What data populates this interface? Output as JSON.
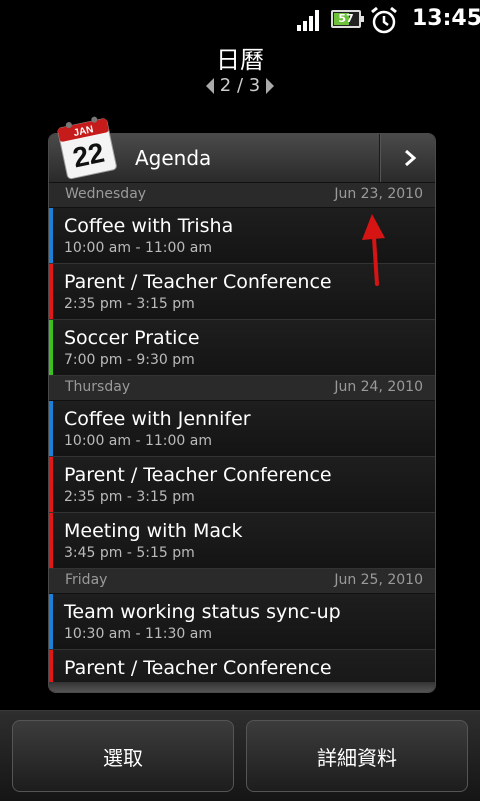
{
  "status_bar": {
    "battery_level": "57",
    "time": "13:45",
    "icons": [
      "signal-icon",
      "battery-icon",
      "alarm-clock-icon"
    ]
  },
  "header": {
    "title": "日曆",
    "page_indicator": "2 / 3"
  },
  "widget": {
    "title": "Agenda",
    "calendar_icon": {
      "month": "JAN",
      "day": "22"
    },
    "days": [
      {
        "day": "Wednesday",
        "date": "Jun 23, 2010",
        "events": [
          {
            "title": "Coffee with Trisha",
            "time": "10:00 am - 11:00 am",
            "color": "#1e7fd6"
          },
          {
            "title": "Parent / Teacher Conference",
            "time": "2:35 pm - 3:15 pm",
            "color": "#e01818"
          },
          {
            "title": "Soccer Pratice",
            "time": "7:00 pm - 9:30 pm",
            "color": "#3cc021"
          }
        ]
      },
      {
        "day": "Thursday",
        "date": "Jun 24, 2010",
        "events": [
          {
            "title": "Coffee with Jennifer",
            "time": "10:00 am - 11:00 am",
            "color": "#1e7fd6"
          },
          {
            "title": "Parent / Teacher Conference",
            "time": "2:35 pm - 3:15 pm",
            "color": "#e01818"
          },
          {
            "title": "Meeting with Mack",
            "time": "3:45 pm - 5:15 pm",
            "color": "#e01818"
          }
        ]
      },
      {
        "day": "Friday",
        "date": "Jun 25, 2010",
        "events": [
          {
            "title": "Team working status sync-up",
            "time": "10:30 am - 11:30 am",
            "color": "#1e7fd6"
          },
          {
            "title": "Parent / Teacher Conference",
            "time": "",
            "color": "#e01818"
          }
        ]
      }
    ]
  },
  "buttons": {
    "select": "選取",
    "details": "詳細資料"
  },
  "colors": {
    "annotation_arrow": "#d61414"
  }
}
